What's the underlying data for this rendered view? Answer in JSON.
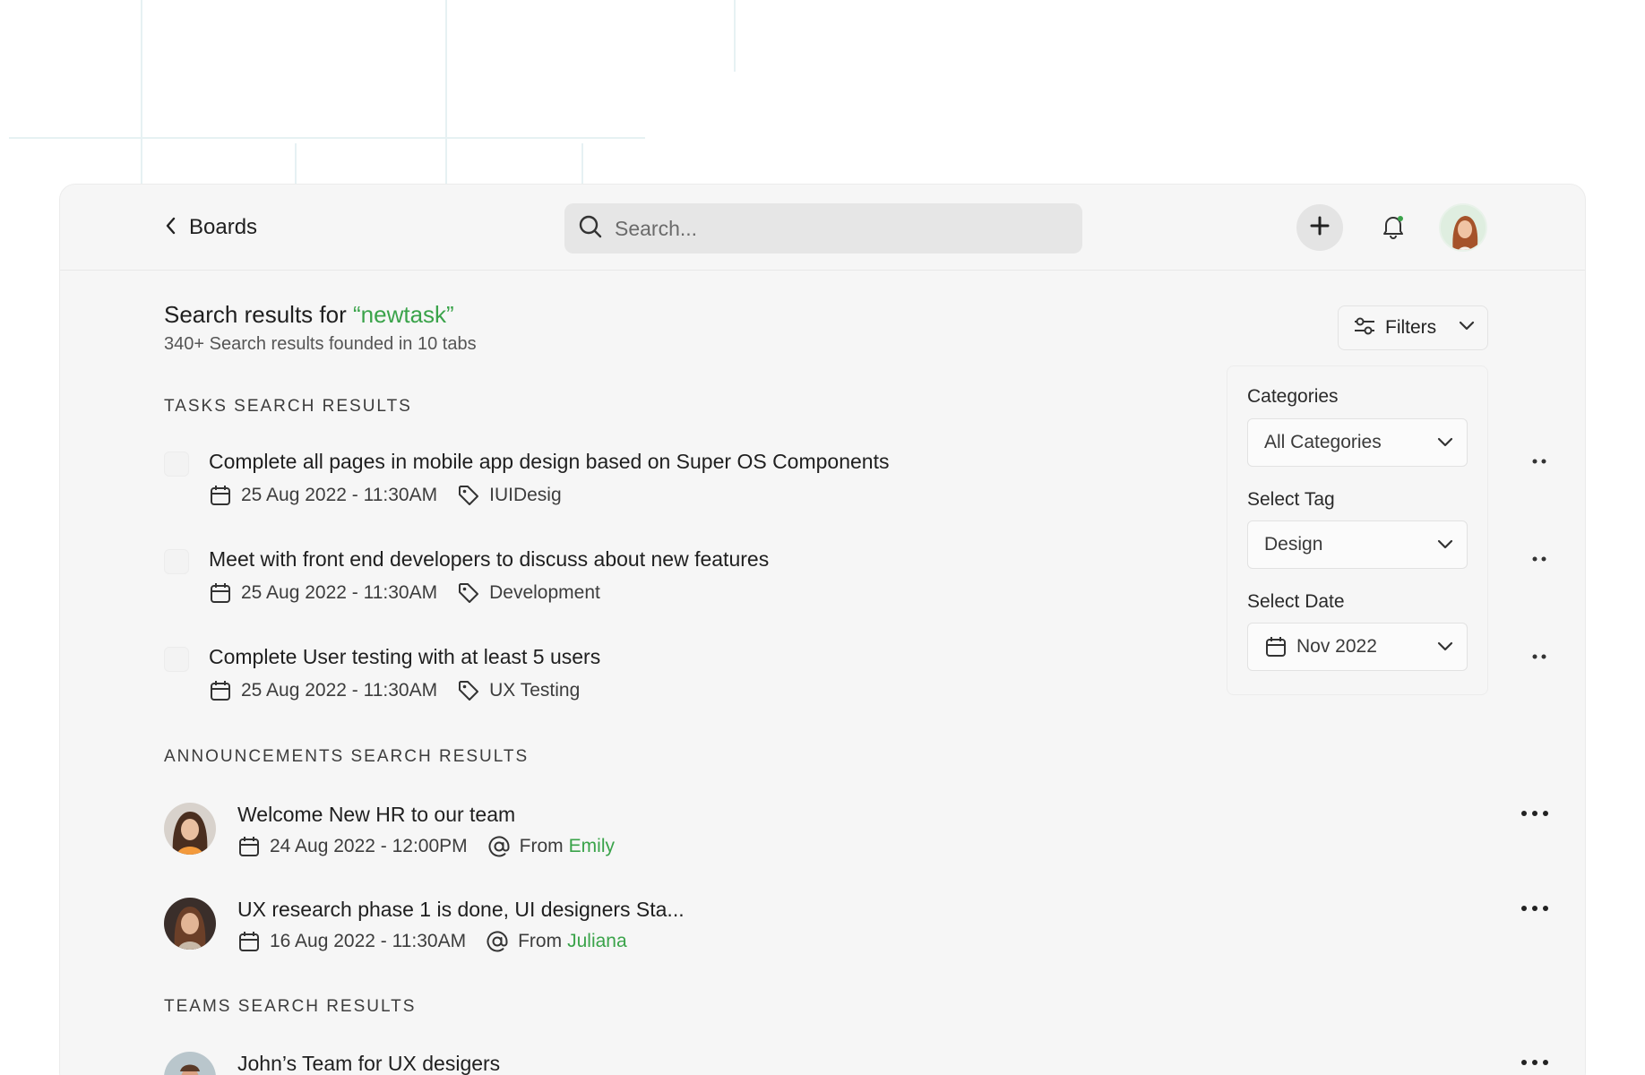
{
  "header": {
    "back_label": "Boards",
    "search_placeholder": "Search..."
  },
  "results": {
    "title_prefix": "Search results for ",
    "query": "“newtask”",
    "subtitle": "340+ Search results founded in 10 tabs"
  },
  "filters": {
    "button_label": "Filters",
    "categories_label": "Categories",
    "categories_value": "All Categories",
    "tag_label": "Select Tag",
    "tag_value": "Design",
    "date_label": "Select Date",
    "date_value": "Nov 2022"
  },
  "sections": {
    "tasks": "TASKS SEARCH RESULTS",
    "announcements": "ANNOUNCEMENTS SEARCH RESULTS",
    "teams": "TEAMS SEARCH RESULTS"
  },
  "tasks": [
    {
      "title": "Complete all pages in mobile app design based on Super OS Components",
      "date": "25 Aug 2022 - 11:30AM",
      "tag": "IUIDesig"
    },
    {
      "title": "Meet with front end developers to discuss about new features",
      "date": "25 Aug 2022 - 11:30AM",
      "tag": "Development"
    },
    {
      "title": "Complete User testing with at least 5 users",
      "date": "25 Aug 2022 - 11:30AM",
      "tag": "UX Testing"
    }
  ],
  "announcements": [
    {
      "title": "Welcome New HR to our team",
      "date": "24 Aug 2022 - 12:00PM",
      "from_label": "From",
      "from": "Emily"
    },
    {
      "title": "UX research phase 1 is done, UI designers Sta...",
      "date": "16 Aug 2022 - 11:30AM",
      "from_label": "From",
      "from": "Juliana"
    }
  ],
  "teams": [
    {
      "title": "John’s Team for UX desigers"
    }
  ],
  "colors": {
    "accent": "#3aa34a",
    "app_bg": "#f6f6f6"
  }
}
